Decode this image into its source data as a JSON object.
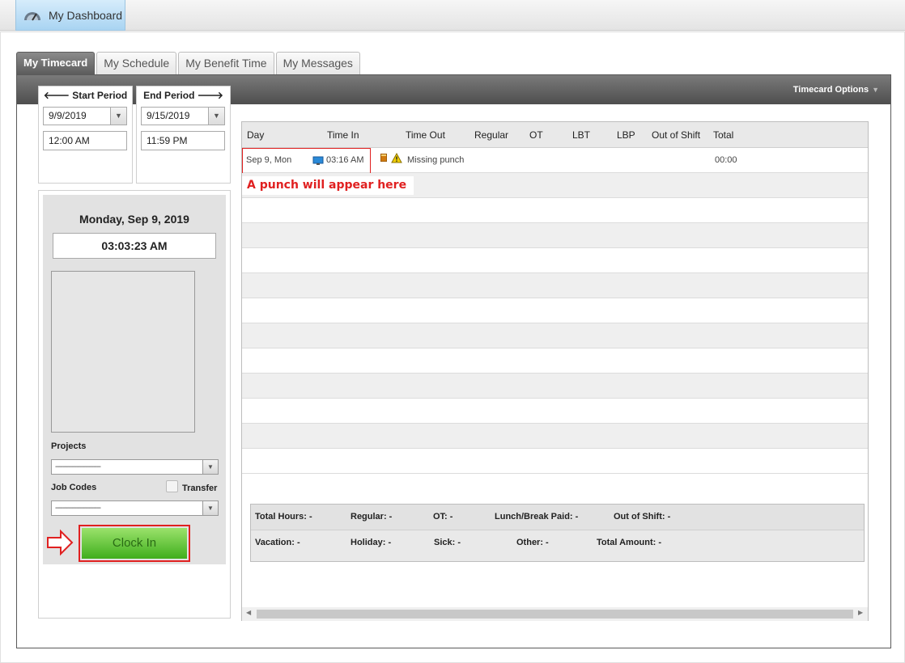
{
  "header": {
    "dashboard_label": "My Dashboard"
  },
  "tabs": [
    "My Timecard",
    "My Schedule",
    "My Benefit Time",
    "My Messages"
  ],
  "options_label": "Timecard Options",
  "period": {
    "start_label": "Start Period",
    "start_date": "9/9/2019",
    "start_time": "12:00 AM",
    "end_label": "End Period",
    "end_date": "9/15/2019",
    "end_time": "11:59 PM"
  },
  "clock": {
    "date": "Monday, Sep 9, 2019",
    "time": "03:03:23 AM",
    "projects_label": "Projects",
    "projects_value": "------------------------",
    "jobcodes_label": "Job Codes",
    "jobcodes_value": "------------------------",
    "transfer_label": "Transfer",
    "clock_in_label": "Clock In"
  },
  "grid": {
    "columns": [
      "Day",
      "Time In",
      "Time Out",
      "Regular",
      "OT",
      "LBT",
      "LBP",
      "Out of Shift",
      "Total"
    ],
    "row": {
      "day": "Sep 9, Mon",
      "time_in": "03:16 AM",
      "status": "Missing punch",
      "total": "00:00"
    },
    "annotation": "A punch will appear here"
  },
  "totals": {
    "total_hours": "Total Hours: -",
    "regular": "Regular: -",
    "ot": "OT: -",
    "lunch_break": "Lunch/Break Paid: -",
    "out_of_shift": "Out of Shift: -",
    "vacation": "Vacation: -",
    "holiday": "Holiday: -",
    "sick": "Sick: -",
    "other": "Other: -",
    "total_amount": "Total Amount: -"
  },
  "colors": {
    "accent_red": "#e02020",
    "clock_green": "#3fae1d",
    "tab_dark": "#5c5c5c"
  },
  "icons": [
    "gauge-icon",
    "arrow-left-icon",
    "arrow-right-icon",
    "monitor-icon",
    "note-icon",
    "warning-icon",
    "pointer-arrow-icon"
  ]
}
